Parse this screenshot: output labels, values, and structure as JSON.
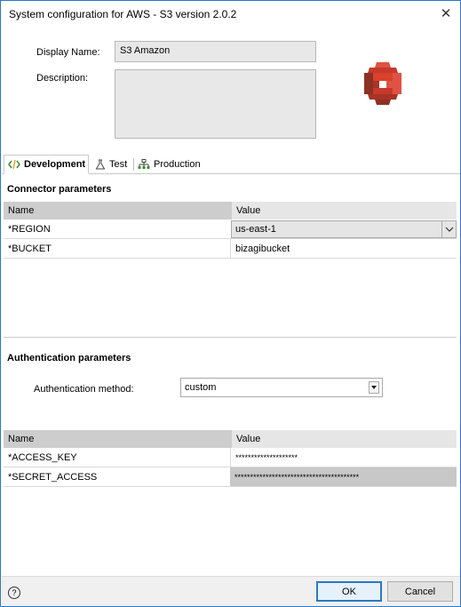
{
  "window": {
    "title": "System configuration for AWS - S3 version 2.0.2",
    "close_glyph": "✕"
  },
  "general": {
    "display_name_label": "Display Name:",
    "display_name_value": "S3 Amazon",
    "description_label": "Description:",
    "description_value": "",
    "logo_icon": "aws-s3-logo",
    "logo_color": "#d9412b"
  },
  "tabs": [
    {
      "label": "Development",
      "icon": "code-icon",
      "active": true
    },
    {
      "label": "Test",
      "icon": "flask-icon",
      "active": false
    },
    {
      "label": "Production",
      "icon": "network-icon",
      "active": false
    }
  ],
  "connector": {
    "title": "Connector parameters",
    "columns": [
      "Name",
      "Value"
    ],
    "rows": [
      {
        "name": "*REGION",
        "value": "us-east-1",
        "type": "dropdown"
      },
      {
        "name": "*BUCKET",
        "value": "bizagibucket",
        "type": "text"
      }
    ]
  },
  "auth": {
    "title": "Authentication parameters",
    "method_label": "Authentication method:",
    "method_value": "custom",
    "columns": [
      "Name",
      "Value"
    ],
    "rows": [
      {
        "name": "*ACCESS_KEY",
        "value": "********************"
      },
      {
        "name": "*SECRET_ACCESS",
        "value": "****************************************"
      }
    ]
  },
  "footer": {
    "help_glyph": "?",
    "ok_label": "OK",
    "cancel_label": "Cancel"
  }
}
